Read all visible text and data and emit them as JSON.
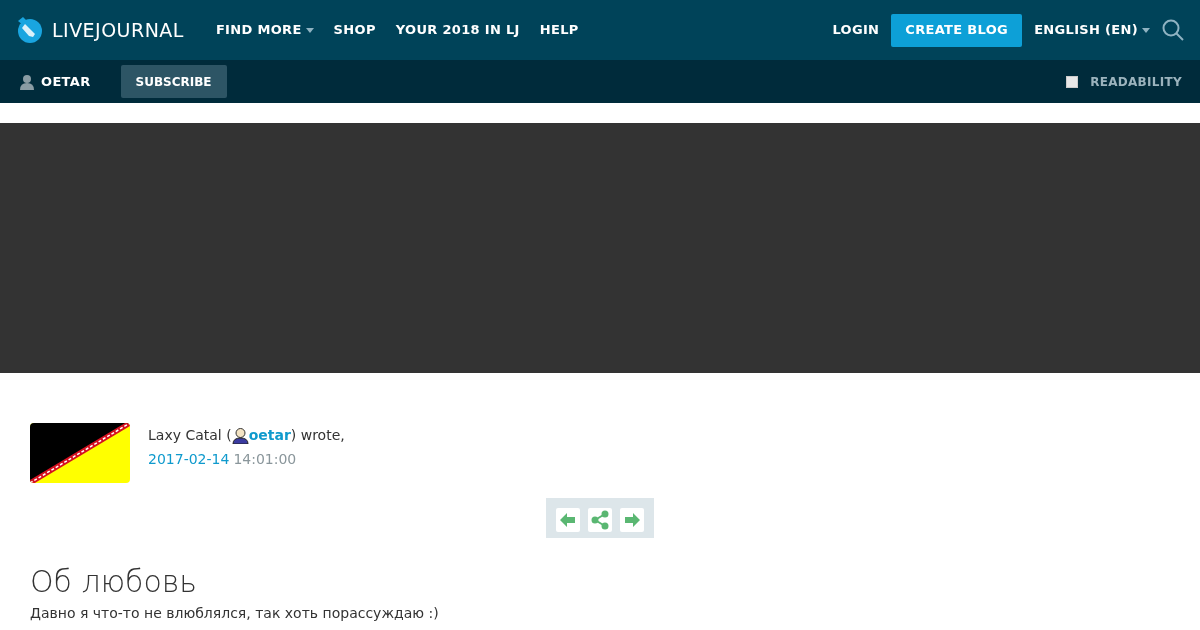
{
  "header": {
    "logo": "LIVEJOURNAL",
    "nav": [
      {
        "label": "FIND MORE",
        "dropdown": true
      },
      {
        "label": "SHOP",
        "dropdown": false
      },
      {
        "label": "YOUR 2018 IN LJ",
        "dropdown": false
      },
      {
        "label": "HELP",
        "dropdown": false
      }
    ],
    "login": "LOGIN",
    "create_blog": "CREATE BLOG",
    "language": "ENGLISH (EN)"
  },
  "subbar": {
    "user": "OETAR",
    "subscribe": "SUBSCRIBE",
    "readability": {
      "label": "READABILITY",
      "checked": false
    }
  },
  "post": {
    "author_before": "Laxy Catal (",
    "author_link": "oetar",
    "author_after": ") wrote,",
    "date": "2017-02-14",
    "time": "14:01:00",
    "title": "Об любовь",
    "text": "Давно я что-то не влюблялся, так хоть порассуждаю :)"
  }
}
